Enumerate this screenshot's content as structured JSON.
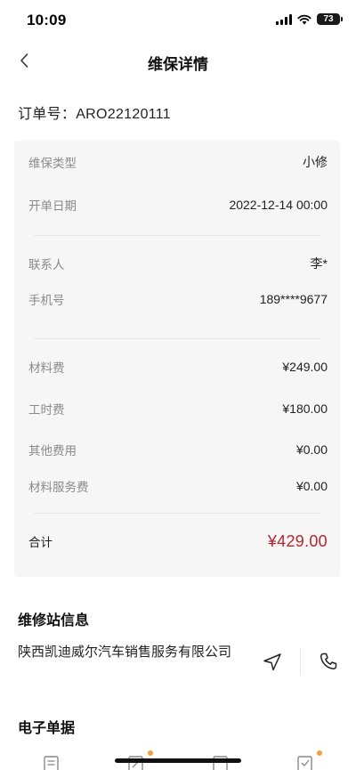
{
  "status_bar": {
    "time": "10:09",
    "battery": "73"
  },
  "nav": {
    "title": "维保详情"
  },
  "order": {
    "label": "订单号：ARO22120111"
  },
  "details": {
    "maintenance_type": {
      "label": "维保类型",
      "value": "小修"
    },
    "open_date": {
      "label": "开单日期",
      "value": "2022-12-14 00:00"
    },
    "contact": {
      "label": "联系人",
      "value": "李*"
    },
    "phone": {
      "label": "手机号",
      "value": "189****9677"
    },
    "material_fee": {
      "label": "材料费",
      "value": "¥249.00"
    },
    "labor_fee": {
      "label": "工时费",
      "value": "¥180.00"
    },
    "other_fee": {
      "label": "其他费用",
      "value": "¥0.00"
    },
    "material_service_fee": {
      "label": "材料服务费",
      "value": "¥0.00"
    },
    "total": {
      "label": "合计",
      "value": "¥429.00"
    }
  },
  "station": {
    "title": "维修站信息",
    "name": "陕西凯迪威尔汽车销售服务有限公司"
  },
  "documents": {
    "title": "电子单据"
  },
  "colors": {
    "accent_red": "#b3262b",
    "badge_orange": "#f0a03c",
    "card_bg": "#f6f6f6"
  },
  "icons": [
    "back-chevron-icon",
    "navigate-icon",
    "phone-icon",
    "document-icon",
    "document-edit-icon",
    "document-list-icon",
    "document-check-icon"
  ]
}
